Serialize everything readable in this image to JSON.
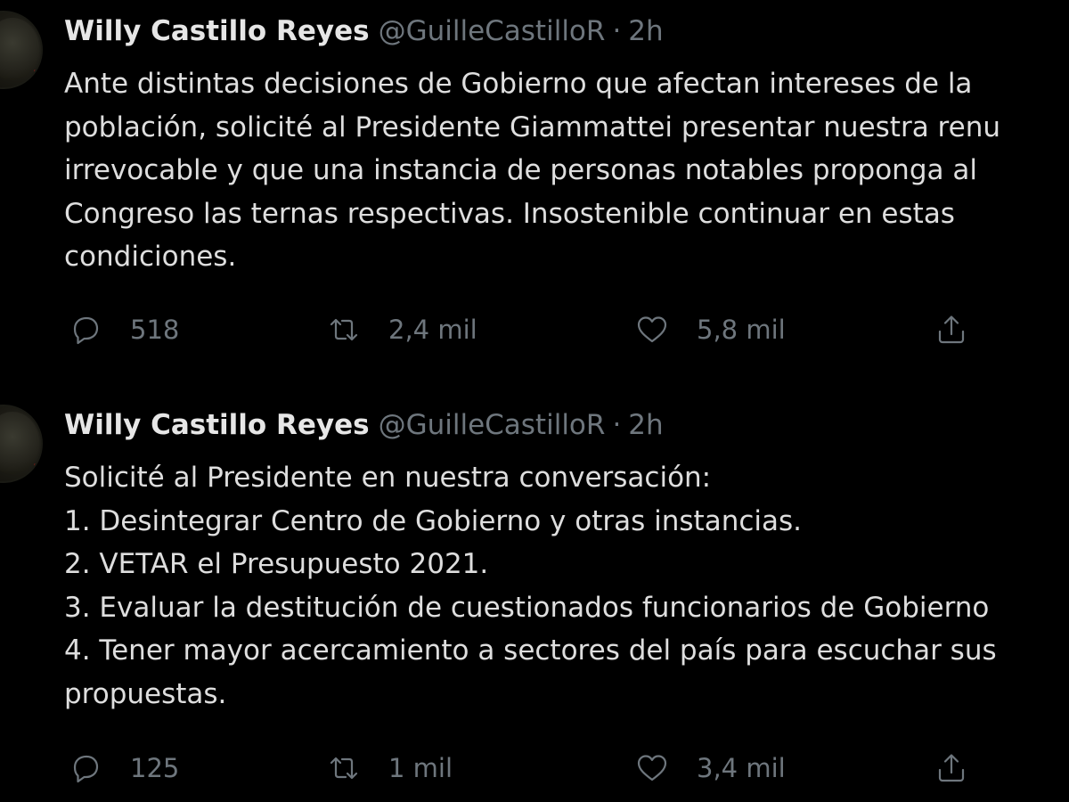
{
  "tweets": [
    {
      "author": {
        "name": "Willy Castillo Reyes",
        "handle": "@GuilleCastilloR",
        "separator": "·",
        "time": "2h"
      },
      "body": "Ante distintas decisiones de Gobierno que afectan intereses de la\npoblación, solicité al Presidente Giammattei presentar nuestra renu\nirrevocable y que una instancia de personas notables proponga al\nCongreso las ternas respectivas. Insostenible continuar en estas\ncondiciones.",
      "actions": {
        "replies": "518",
        "retweets": "2,4 mil",
        "likes": "5,8 mil"
      }
    },
    {
      "author": {
        "name": "Willy Castillo Reyes",
        "handle": "@GuilleCastilloR",
        "separator": "·",
        "time": "2h"
      },
      "body": "Solicité al Presidente en nuestra conversación:\n1. Desintegrar Centro de Gobierno y otras instancias.\n2. VETAR el Presupuesto 2021.\n3. Evaluar la destitución de cuestionados funcionarios de Gobierno\n4. Tener mayor acercamiento a sectores del país para escuchar sus\npropuestas.",
      "actions": {
        "replies": "125",
        "retweets": "1 mil",
        "likes": "3,4 mil"
      }
    }
  ],
  "icons": {
    "reply": "reply-icon",
    "retweet": "retweet-icon",
    "like": "heart-icon",
    "share": "share-icon"
  },
  "colors": {
    "background": "#000000",
    "text": "#d9d9d9",
    "muted": "#6e767d"
  }
}
